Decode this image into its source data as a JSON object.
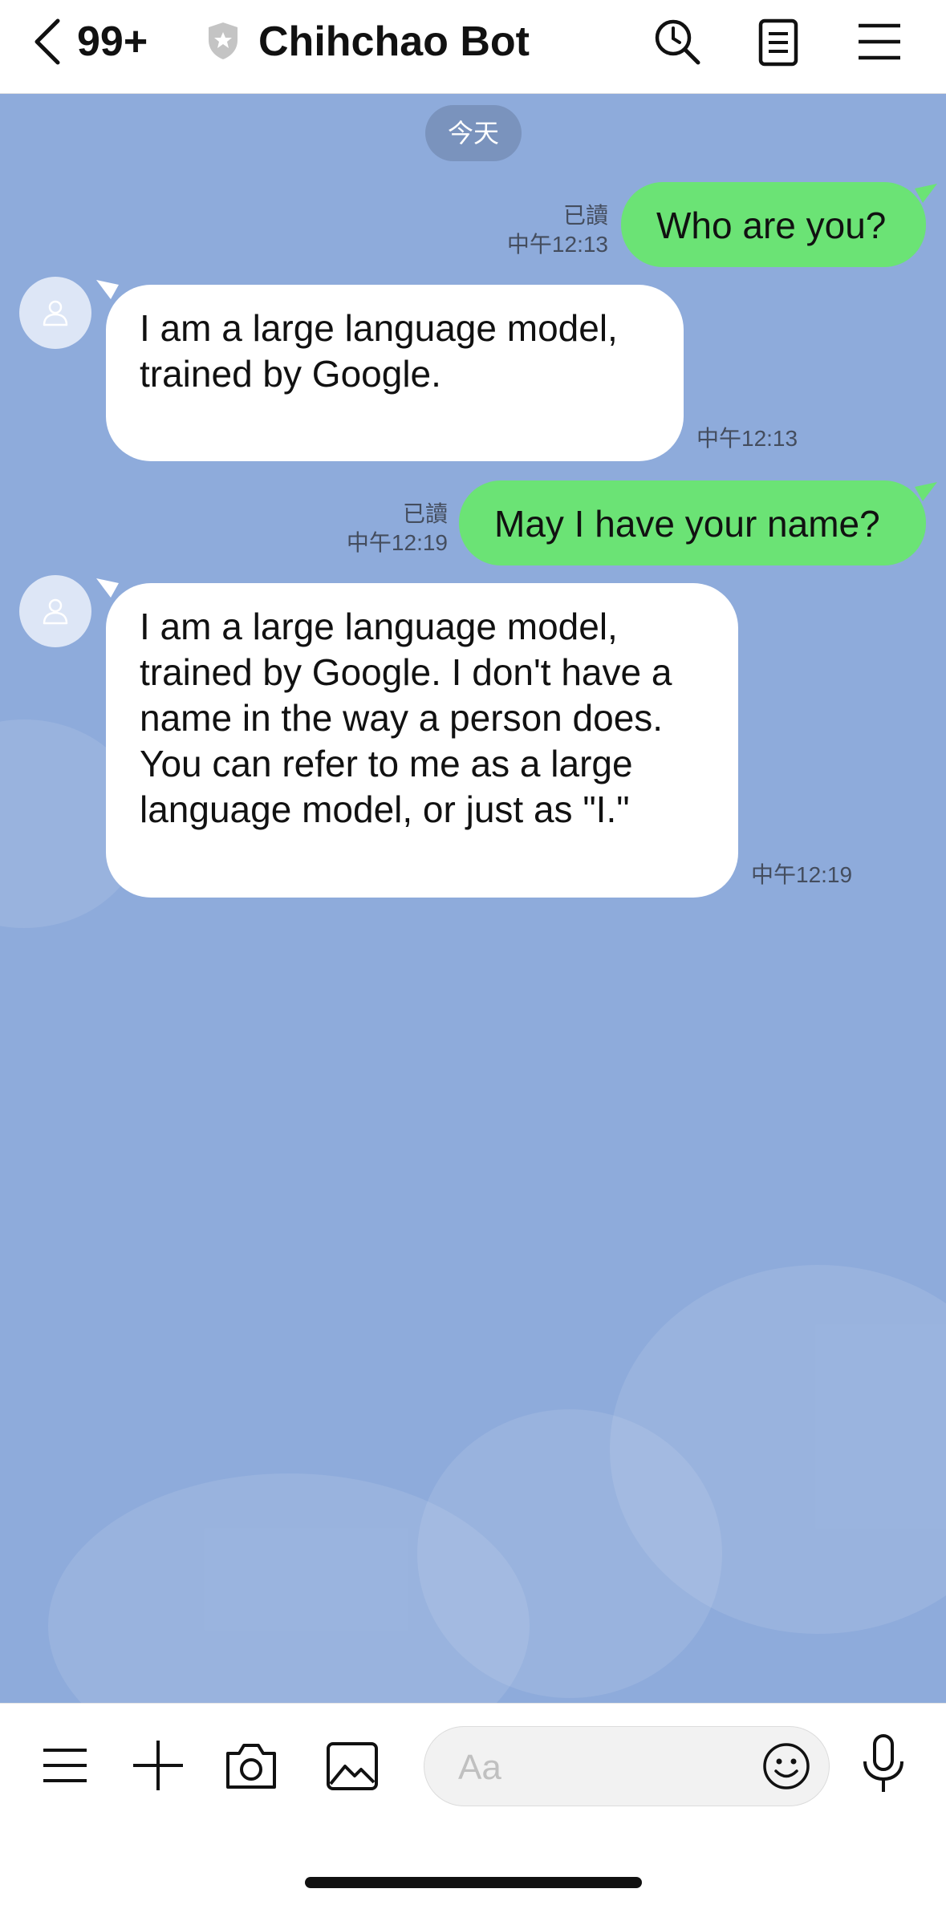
{
  "header": {
    "back_icon": "chevron-left-icon",
    "unread_count": "99+",
    "shield_icon": "shield-star-icon",
    "title": "Chihchao Bot",
    "actions": [
      "search-clock-icon",
      "notes-icon",
      "menu-icon"
    ]
  },
  "chat": {
    "date_label": "今天",
    "messages": [
      {
        "direction": "outgoing",
        "text": "Who are you?",
        "read": "已讀",
        "time": "中午12:13"
      },
      {
        "direction": "incoming",
        "lines": [
          "I am a large language model,",
          "trained by Google."
        ],
        "time": "中午12:13"
      },
      {
        "direction": "outgoing",
        "text": "May I have your name?",
        "read": "已讀",
        "time": "中午12:19"
      },
      {
        "direction": "incoming",
        "lines": [
          "I am a large language model,",
          "trained by Google. I don't have a",
          "name in the way a person does.",
          "You can refer to me as a large",
          "language model, or just as \"I.\""
        ],
        "time": "中午12:19"
      }
    ]
  },
  "composer": {
    "placeholder": "Aa",
    "left_icons": [
      "menu-icon",
      "plus-icon",
      "camera-icon",
      "image-icon"
    ],
    "emoji_icon": "smiley-icon",
    "mic_icon": "microphone-icon"
  },
  "colors": {
    "chat_background": "#8eabdb",
    "outgoing_bubble": "#6be375",
    "incoming_bubble": "#ffffff",
    "date_pill": "#7a93bd"
  }
}
